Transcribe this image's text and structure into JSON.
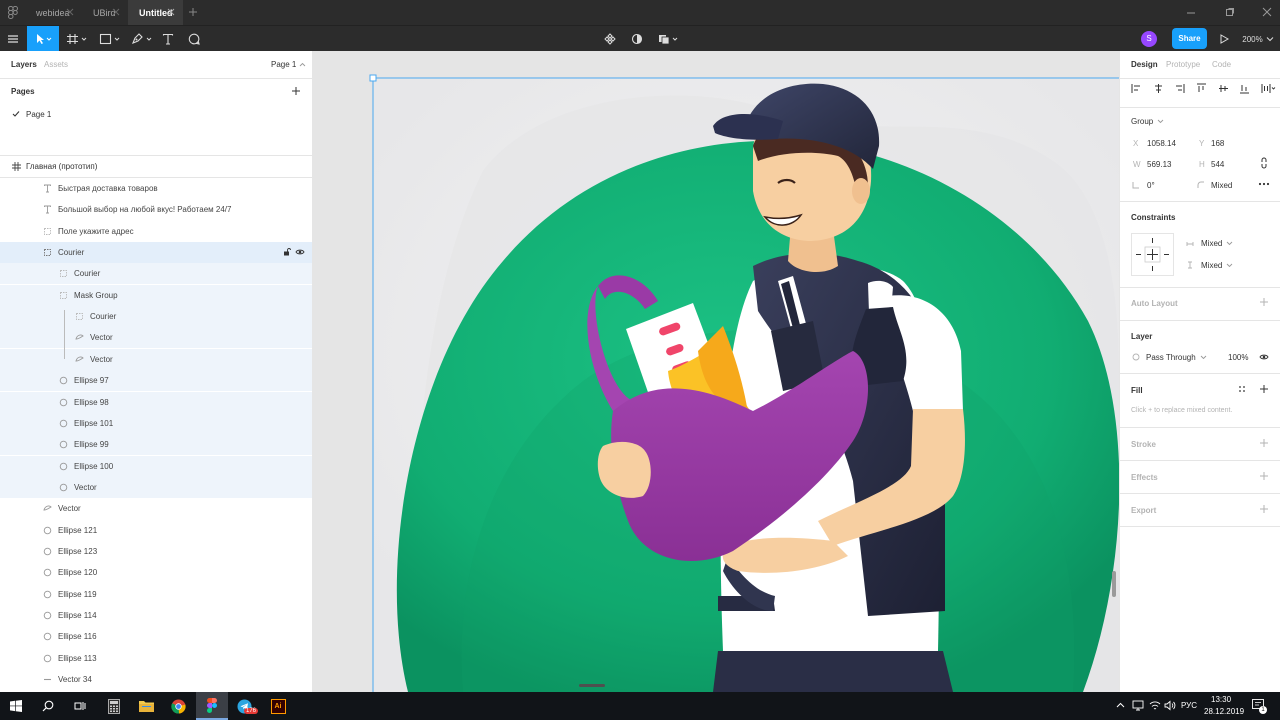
{
  "titlebar": {
    "tabs": [
      {
        "label": "webidea"
      },
      {
        "label": "UBird"
      },
      {
        "label": "Untitled"
      }
    ]
  },
  "toolbar": {
    "share_label": "Share",
    "zoom": "200%",
    "avatar_letter": "S",
    "accent": "#18a0fb",
    "avatar_color": "#9747ff"
  },
  "left": {
    "tabs": {
      "layers": "Layers",
      "assets": "Assets"
    },
    "page_selector": "Page 1",
    "pages_header": "Pages",
    "pages": [
      {
        "label": "Page 1"
      }
    ],
    "frame_label": "Главная (прототип)",
    "layers": [
      {
        "label": "Быстрая доставка товаров",
        "icon": "text-icon"
      },
      {
        "label": "Большой выбор на любой вкус! Работаем 24/7",
        "icon": "text-icon"
      },
      {
        "label": "Поле укажите адрес",
        "icon": "rect-icon"
      },
      {
        "label": "Courier",
        "icon": "group-icon"
      },
      {
        "label": "Courier",
        "icon": "rect-icon"
      },
      {
        "label": "Mask Group",
        "icon": "rect-icon"
      },
      {
        "label": "Courier",
        "icon": "rect-icon"
      },
      {
        "label": "Vector",
        "icon": "vector-icon"
      },
      {
        "label": "Vector",
        "icon": "vector-icon"
      },
      {
        "label": "Ellipse 97",
        "icon": "ellipse-icon"
      },
      {
        "label": "Ellipse 98",
        "icon": "ellipse-icon"
      },
      {
        "label": "Ellipse 101",
        "icon": "ellipse-icon"
      },
      {
        "label": "Ellipse 99",
        "icon": "ellipse-icon"
      },
      {
        "label": "Ellipse 100",
        "icon": "ellipse-icon"
      },
      {
        "label": "Vector",
        "icon": "ellipse-icon"
      },
      {
        "label": "Vector",
        "icon": "vector-icon"
      },
      {
        "label": "Ellipse 121",
        "icon": "ellipse-icon"
      },
      {
        "label": "Ellipse 123",
        "icon": "ellipse-icon"
      },
      {
        "label": "Ellipse 120",
        "icon": "ellipse-icon"
      },
      {
        "label": "Ellipse 119",
        "icon": "ellipse-icon"
      },
      {
        "label": "Ellipse 114",
        "icon": "ellipse-icon"
      },
      {
        "label": "Ellipse 116",
        "icon": "ellipse-icon"
      },
      {
        "label": "Ellipse 113",
        "icon": "ellipse-icon"
      },
      {
        "label": "Vector 34",
        "icon": "line-icon"
      }
    ]
  },
  "right": {
    "tabs": {
      "design": "Design",
      "prototype": "Prototype",
      "code": "Code"
    },
    "group_label": "Group",
    "x_label": "X",
    "x": "1058.14",
    "y_label": "Y",
    "y": "168",
    "w_label": "W",
    "w": "569.13",
    "h_label": "H",
    "h": "544",
    "rotation": "0°",
    "radius": "Mixed",
    "constraints_header": "Constraints",
    "constraint_h": "Mixed",
    "constraint_v": "Mixed",
    "auto_layout": "Auto Layout",
    "layer_header": "Layer",
    "blend_mode": "Pass Through",
    "opacity": "100%",
    "fill_header": "Fill",
    "fill_hint": "Click + to replace mixed content.",
    "stroke": "Stroke",
    "effects": "Effects",
    "export": "Export"
  },
  "taskbar": {
    "lang": "РУС",
    "time": "13:30",
    "date": "28.12.2019",
    "notif_count": "1",
    "telegram_badge": "176"
  },
  "help_label": "?"
}
